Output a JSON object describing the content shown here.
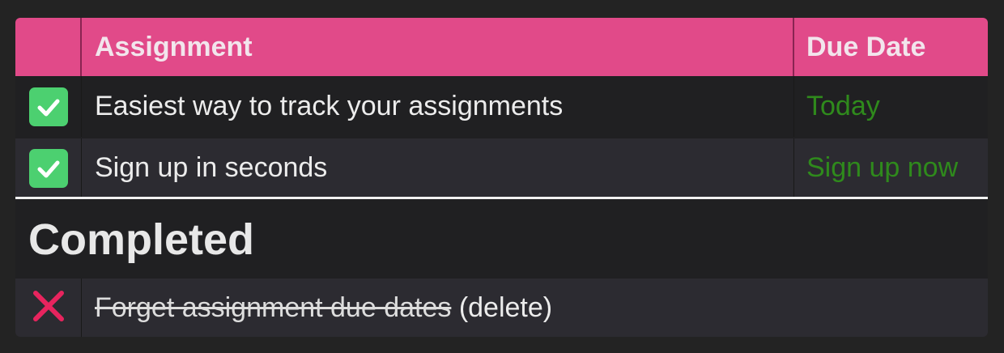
{
  "table": {
    "headers": [
      "",
      "Assignment",
      "Due Date"
    ],
    "rows": [
      {
        "checked": true,
        "assignment": "Easiest way to track your assignments",
        "due": "Today"
      },
      {
        "checked": true,
        "assignment": "Sign up in seconds",
        "due": "Sign up now"
      }
    ]
  },
  "completed": {
    "title": "Completed",
    "items": [
      {
        "assignment": "Forget assignment due dates",
        "delete_label": "(delete)"
      }
    ]
  },
  "colors": {
    "header": "#e14a89",
    "check": "#4cd070",
    "due": "#2f8a1c",
    "delete_icon": "#e8245e"
  },
  "icons": {
    "row_status": "checkmark-icon",
    "completed_status": "x-icon"
  }
}
